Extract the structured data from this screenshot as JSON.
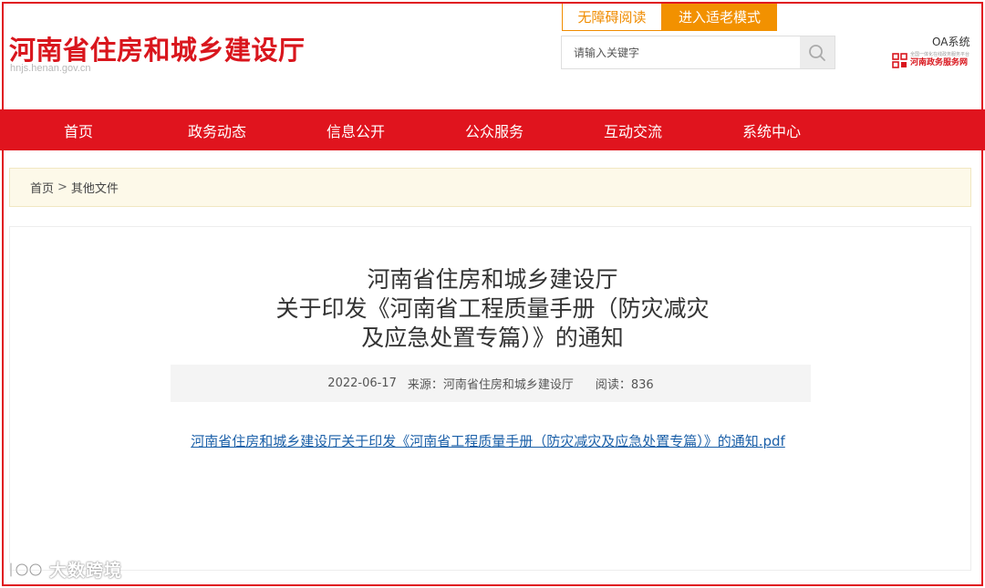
{
  "header": {
    "title": "河南省住房和城乡建设厅",
    "url": "hnjs.henan.gov.cn",
    "accessibility_label": "无障碍阅读",
    "elder_mode_label": "进入适老模式",
    "search": {
      "placeholder": "请输入关键字",
      "icon": "search-icon"
    },
    "oa_label": "OA系统",
    "gov_service": {
      "small_text": "全国一体化在线政务服务平台",
      "main_text": "河南政务服务网"
    }
  },
  "nav": {
    "items": [
      {
        "label": "首页"
      },
      {
        "label": "政务动态"
      },
      {
        "label": "信息公开"
      },
      {
        "label": "公众服务"
      },
      {
        "label": "互动交流"
      },
      {
        "label": "系统中心"
      }
    ]
  },
  "breadcrumb": {
    "home": "首页",
    "separator": ">",
    "current": "其他文件"
  },
  "article": {
    "title_lines": [
      "河南省住房和城乡建设厅",
      "关于印发《河南省工程质量手册（防灾减灾",
      "及应急处置专篇）》的通知"
    ],
    "date": "2022-06-17",
    "source": "来源：河南省住房和城乡建设厅",
    "reads": "阅读：836",
    "attachment": "河南省住房和城乡建设厅关于印发《河南省工程质量手册（防灾减灾及应急处置专篇）》的通知.pdf"
  },
  "watermark": {
    "text": "大数跨境"
  },
  "colors": {
    "brand_red": "#e0141e",
    "accent_orange": "#f29100",
    "link_blue": "#1a5fa8"
  }
}
